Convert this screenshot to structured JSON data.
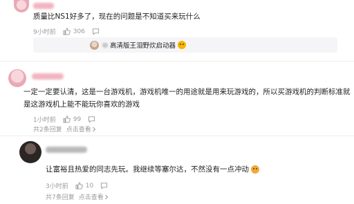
{
  "comments": [
    {
      "text_lines": [
        "质量比NS1好多了，现在的问题是不知道买来玩什么"
      ],
      "time": "9小时前",
      "likes": "306",
      "reply": {
        "text": "高清版王泪野炊启动器",
        "emoji": "emoji-face-icon"
      }
    },
    {
      "text_lines": [
        "一定一定要认清，这是一台游戏机，游戏机唯一的用途就是用来玩游戏的，所以买游戏机的判断标准就",
        "是这游戏机上能不能玩你喜欢的游戏"
      ],
      "time": "1小时前",
      "likes": "99",
      "expand": "共2条回复",
      "view_more": "点击查看"
    },
    {
      "text_lines": [
        "让富裕且热爱的同志先玩。我继续等塞尔达，不然没有一点冲动"
      ],
      "time": "3小时前",
      "likes": "10",
      "expand": "共7条回复",
      "view_more": "点击查看",
      "emoji": "emoji-face-icon"
    }
  ]
}
